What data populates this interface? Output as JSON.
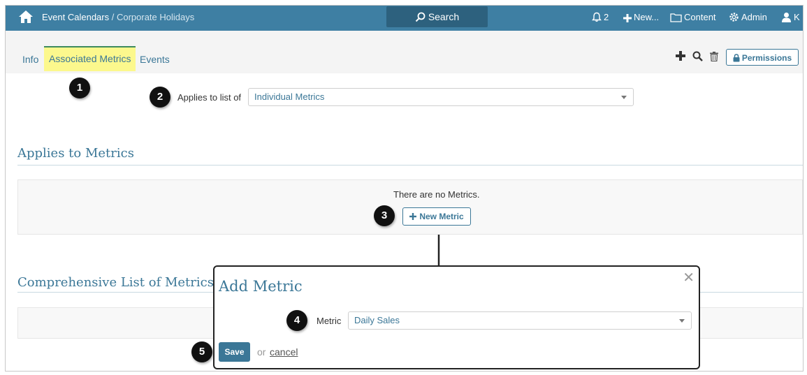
{
  "nav": {
    "breadcrumb_root": "Event Calendars",
    "breadcrumb_sep": " / ",
    "breadcrumb_current": "Corporate Holidays",
    "search_label": "Search",
    "notifications_count": "2",
    "new_label": "New...",
    "content_label": "Content",
    "admin_label": "Admin",
    "user_initial": "K"
  },
  "tabs": [
    {
      "label": "Info"
    },
    {
      "label": "Associated Metrics"
    },
    {
      "label": "Events"
    }
  ],
  "toolbar": {
    "permissions_label": "Permissions"
  },
  "applies": {
    "label": "Applies to list of",
    "value": "Individual Metrics"
  },
  "applies_section": {
    "title": "Applies to Metrics",
    "empty_text": "There are no Metrics.",
    "new_metric_label": "New Metric"
  },
  "comprehensive_section": {
    "title": "Comprehensive List of Metrics"
  },
  "modal": {
    "title": "Add Metric",
    "metric_label": "Metric",
    "metric_value": "Daily Sales",
    "save_label": "Save",
    "or_text": "or",
    "cancel_label": "cancel",
    "close_glyph": "✕"
  },
  "callouts": [
    "1",
    "2",
    "3",
    "4",
    "5"
  ],
  "colors": {
    "topbar": "#3e7fa3",
    "accent": "#3b7797",
    "active_tab": "#fcf88d"
  }
}
